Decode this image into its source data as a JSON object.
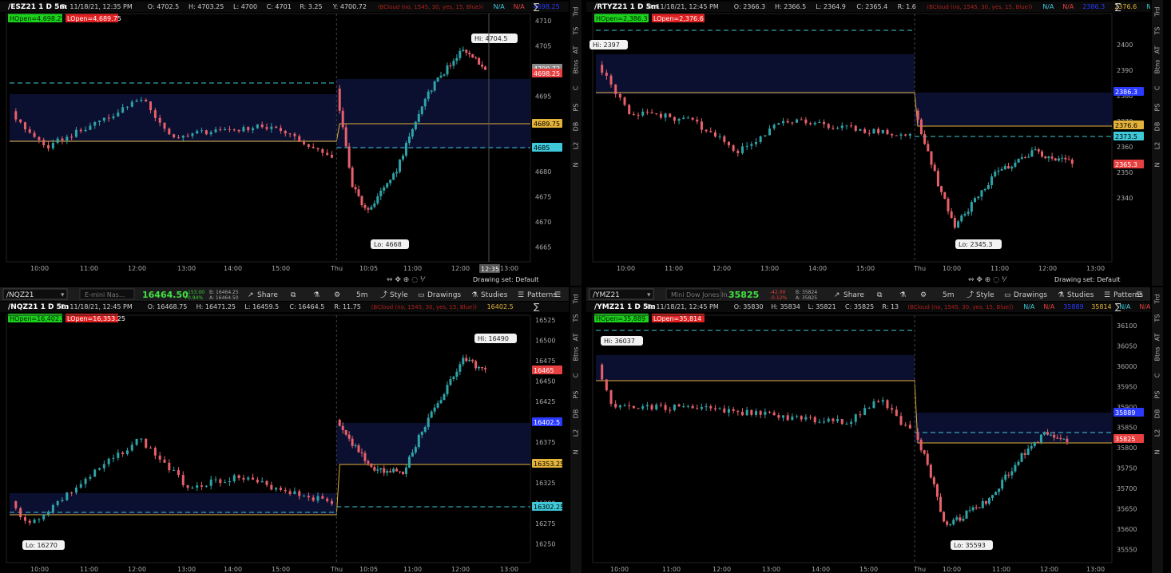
{
  "panels": [
    {
      "id": "esz",
      "symbol": "/ESZ21 1 D 5m",
      "header_fields": [
        "D: 11/18/21, 12:35 PM",
        "O: 4702.5",
        "H: 4703.25",
        "L: 4700",
        "C: 4701",
        "R: 3.25",
        "Y: 4700.72"
      ],
      "study_text": "(BCloud (no, 1545, 30, yes, 15, Blue))",
      "na_fields": [
        "N/A",
        "N/A",
        "4698.25",
        "4689.75"
      ],
      "hopen": "HOpen=4,698.25",
      "lopen": "LOpen=4,689.75",
      "y_ticks": [
        "4710",
        "4705",
        "4700",
        "4695",
        "4690",
        "4685",
        "4680",
        "4675",
        "4670",
        "4665"
      ],
      "x_ticks": [
        "10:00",
        "11:00",
        "12:00",
        "13:00",
        "14:00",
        "15:00",
        "Thu",
        "10:05",
        "11:00",
        "12:00",
        "13:00"
      ],
      "price_tags": [
        "4700.72",
        "4698.25",
        "4689.75",
        "4685"
      ],
      "hi": "Hi: 4704.5",
      "lo": "Lo: 4668",
      "time_tag": "12:35",
      "drawing_set": "Drawing set: Default",
      "side_tabs": [
        "Trd",
        "TS",
        "AT",
        "Btns",
        "C",
        "PS",
        "DB",
        "L2",
        "N"
      ]
    },
    {
      "id": "rty",
      "symbol": "/RTYZ21 1 D 5m",
      "header_fields": [
        "D: 11/18/21, 12:45 PM",
        "O: 2366.3",
        "H: 2366.5",
        "L: 2364.9",
        "C: 2365.4",
        "R: 1.6"
      ],
      "study_text": "(BCloud (no, 1545, 30, yes, 15, Blue))",
      "na_fields": [
        "N/A",
        "N/A",
        "2386.3",
        "2376.6",
        "N/A",
        "N/A"
      ],
      "hopen": "HOpen=2,386.3",
      "lopen": "LOpen=2,376.6",
      "y_ticks": [
        "2400",
        "2390",
        "2380",
        "2370",
        "2360",
        "2350",
        "2340"
      ],
      "x_ticks": [
        "10:00",
        "11:00",
        "12:00",
        "13:00",
        "14:00",
        "15:00",
        "Thu",
        "10:00",
        "11:00",
        "12:00",
        "13:00"
      ],
      "price_tags": [
        "2386.3",
        "2376.6",
        "2373.5",
        "2365.3"
      ],
      "hi": "Hi: 2397",
      "lo": "Lo: 2345.3",
      "drawing_set": "Drawing set: Default",
      "side_tabs": [
        "Trd",
        "TS",
        "AT",
        "Btns",
        "C",
        "PS",
        "DB",
        "L2",
        "N"
      ]
    },
    {
      "id": "nq",
      "toolbar": {
        "symbol": "/NQZ21",
        "description": "E-mini Nas...",
        "last": "16464.50",
        "change": "+153.00",
        "change_pct": "+0.94%",
        "bid": "B: 16464.25",
        "ask": "A: 16464.50",
        "share": "Share",
        "interval": "5m",
        "style": "Style",
        "drawings": "Drawings",
        "studies": "Studies",
        "patterns": "Patterns"
      },
      "symbol": "/NQZ21 1 D 5m",
      "header_fields": [
        "D: 11/18/21, 12:45 PM",
        "O: 16468.75",
        "H: 16471.25",
        "L: 16459.5",
        "C: 16464.5",
        "R: 11.75"
      ],
      "study_text": "(BCloud (no, 1545, 30, yes, 15, Blue))",
      "na_fields": [
        "16402.5"
      ],
      "hopen": "HOpen=16,402.5",
      "lopen": "LOpen=16,353.25",
      "y_ticks": [
        "16525",
        "16500",
        "16475",
        "16450",
        "16425",
        "16400",
        "16375",
        "16350",
        "16325",
        "16300",
        "16275",
        "16250"
      ],
      "x_ticks": [
        "10:00",
        "11:00",
        "12:00",
        "13:00",
        "14:00",
        "15:00",
        "Thu",
        "10:05",
        "11:00",
        "12:00",
        "13:00"
      ],
      "price_tags": [
        "16465",
        "16402.5",
        "16353.25",
        "16302.25"
      ],
      "hi": "Hi: 16490",
      "lo": "Lo: 16270",
      "side_tabs": []
    },
    {
      "id": "ym",
      "toolbar": {
        "symbol": "/YMZ21",
        "description": "Mini Dow Jones In...",
        "last": "35825",
        "change": "-42.00",
        "change_pct": "-0.12%",
        "bid": "B: 35824",
        "ask": "A: 35825",
        "share": "Share",
        "interval": "5m",
        "style": "Style",
        "drawings": "Drawings",
        "studies": "Studies",
        "patterns": "Patterns"
      },
      "symbol": "/YMZ21 1 D 5m",
      "header_fields": [
        "D: 11/18/21, 12:45 PM",
        "O: 35830",
        "H: 35834",
        "L: 35821",
        "C: 35825",
        "R: 13"
      ],
      "study_text": "(BCloud (no, 1545, 30, yes, 15, Blue))",
      "na_fields": [
        "N/A",
        "N/A",
        "35889",
        "35814",
        "N/A",
        "N/A"
      ],
      "hopen": "HOpen=35,889",
      "lopen": "LOpen=35,814",
      "y_ticks": [
        "36100",
        "36050",
        "36000",
        "35950",
        "35900",
        "35850",
        "35800",
        "35750",
        "35700",
        "35650",
        "35600",
        "35550"
      ],
      "x_ticks": [
        "10:00",
        "11:00",
        "12:00",
        "13:00",
        "14:00",
        "15:00",
        "Thu",
        "10:00",
        "11:00",
        "12:00",
        "13:00"
      ],
      "price_tags": [
        "35889",
        "35825"
      ],
      "hi": "Hi: 36037",
      "lo": "Lo: 35593",
      "side_tabs": [
        "Trd",
        "TS",
        "AT",
        "Btns",
        "C",
        "PS",
        "DB",
        "L2",
        "N"
      ]
    }
  ],
  "colors": {
    "up": "#2fa3a8",
    "down": "#e8606a",
    "hopen_bg": "#1bd11b",
    "lopen_bg": "#e02020",
    "cyan": "#3fc8d8",
    "orange": "#e2b23a",
    "cloud": "#0c1030"
  }
}
